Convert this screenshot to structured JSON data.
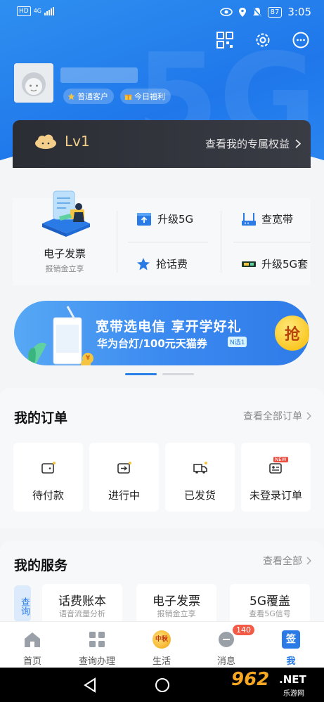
{
  "status_bar": {
    "network_label": "HD",
    "network_type": "4G",
    "battery": "87",
    "time": "3:05"
  },
  "header": {
    "tags": [
      {
        "label": "普通客户",
        "icon": "star-icon"
      },
      {
        "label": "今日福利",
        "icon": "gift-icon"
      }
    ]
  },
  "level_card": {
    "level": "Lv1",
    "rights_link": "查看我的专属权益"
  },
  "quick": {
    "invoice_title": "电子发票",
    "invoice_sub": "报销金立享",
    "items": [
      {
        "label": "升级5G",
        "icon": "upload-icon"
      },
      {
        "label": "查宽带",
        "icon": "router-icon"
      },
      {
        "label": "抢话费",
        "icon": "star-icon"
      },
      {
        "label": "升级5G套",
        "icon": "sim-card-icon"
      }
    ]
  },
  "banner": {
    "line1": "宽带选电信 享开学好礼",
    "line2": "华为台灯/100元天猫券",
    "badge": "N选1",
    "button": "抢",
    "coin": "¥"
  },
  "orders": {
    "title": "我的订单",
    "more": "查看全部订单",
    "items": [
      {
        "label": "待付款"
      },
      {
        "label": "进行中"
      },
      {
        "label": "已发货"
      },
      {
        "label": "未登录订单",
        "badge": "NEW"
      }
    ]
  },
  "services": {
    "title": "我的服务",
    "more": "查看全部",
    "side_tab": "查询",
    "items": [
      {
        "title": "话费账本",
        "sub": "语音流量分析"
      },
      {
        "title": "电子发票",
        "sub": "报销金立享"
      },
      {
        "title": "5G覆盖",
        "sub": "查看5G信号"
      }
    ]
  },
  "tabbar": {
    "tabs": [
      {
        "label": "首页"
      },
      {
        "label": "查询办理"
      },
      {
        "label": "生活",
        "icon_text": "中秋"
      },
      {
        "label": "消息",
        "badge": "140"
      },
      {
        "label": "我",
        "icon_text": "签"
      }
    ]
  },
  "watermark": {
    "brand": "962",
    "net": ".NET",
    "site": "乐游网"
  },
  "colors": {
    "brand_blue": "#1f77ea",
    "level_gold": "#f3cf8a",
    "badge_red": "#f35b47"
  }
}
